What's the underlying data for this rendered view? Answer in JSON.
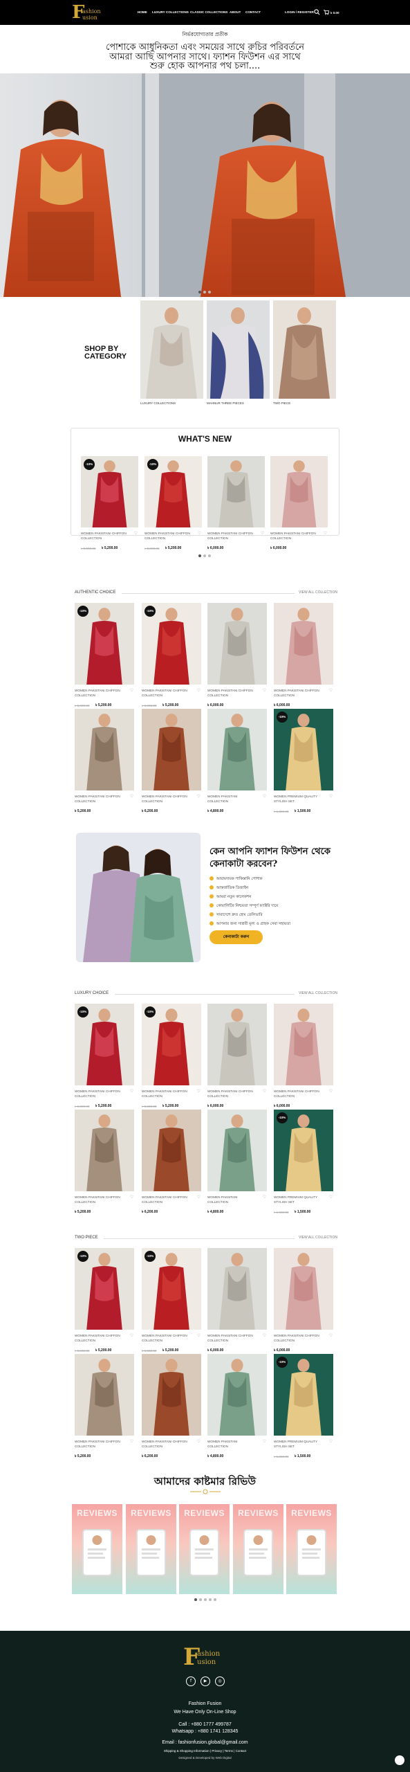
{
  "header": {
    "logo_letter": "F",
    "logo_word1": "ashion",
    "logo_word2": "usion",
    "nav": [
      "HOME",
      "LUXURY COLLECTIONS",
      "CLASSIC COLLECTIONS",
      "ABOUT",
      "CONTACT"
    ],
    "login": "LOGIN / REGISTER",
    "cart_total": "৳ 0.00",
    "cart_count": "0"
  },
  "intro": {
    "subtitle": "নির্ভরযোগ্যতার প্রতীক",
    "line1": "পোশাকে আধুনিকতা এবং সময়ের সাথে রুচির পরিবর্তনে",
    "line2": "আমরা আছি আপনার সাথে। ফ্যাশন ফিউশন এর সাথে",
    "line3": "শুরু হোক আপনার পথ চলা...."
  },
  "category": {
    "heading_line1": "SHOP BY",
    "heading_line2": "CATEGORY",
    "items": [
      "Luxury Collections",
      "Mahnur Three Pieces",
      "Two Piece"
    ]
  },
  "whats_new": {
    "title": "WHAT'S NEW",
    "products": [
      {
        "badge": "-10%",
        "name": "WOMEN PAKISTANI CHIFFON COLLECTION",
        "old": "৳ 5,800.00",
        "price": "৳ 5,200.00"
      },
      {
        "badge": "-10%",
        "name": "WOMEN PAKISTANI CHIFFON COLLECTION",
        "old": "৳ 5,800.00",
        "price": "৳ 5,200.00"
      },
      {
        "badge": "",
        "name": "WOMEN PAKISTANI CHIFFON COLLECTION",
        "old": "",
        "price": "৳ 6,000.00"
      },
      {
        "badge": "",
        "name": "WOMEN PAKISTANI CHIFFON COLLECTION",
        "old": "",
        "price": "৳ 6,000.00"
      }
    ]
  },
  "authentic": {
    "title": "AUTHENTIC CHOICE",
    "link": "VIEW ALL COLLECTION",
    "products": [
      {
        "badge": "-10%",
        "name": "WOMEN PAKISTANI CHIFFON COLLECTION",
        "old": "৳ 5,800.00",
        "price": "৳ 5,200.00"
      },
      {
        "badge": "-10%",
        "name": "WOMEN PAKISTANI CHIFFON COLLECTION",
        "old": "৳ 5,800.00",
        "price": "৳ 5,200.00"
      },
      {
        "badge": "",
        "name": "WOMEN PAKISTANI CHIFFON COLLECTION",
        "old": "",
        "price": "৳ 6,000.00"
      },
      {
        "badge": "",
        "name": "WOMEN PAKISTANI CHIFFON COLLECTION",
        "old": "",
        "price": "৳ 6,000.00"
      },
      {
        "badge": "",
        "name": "WOMEN PAKISTANI CHIFFON COLLECTION",
        "old": "",
        "price": "৳ 5,200.00"
      },
      {
        "badge": "",
        "name": "WOMEN PAKISTANI CHIFFON COLLECTION",
        "old": "",
        "price": "৳ 6,200.00"
      },
      {
        "badge": "",
        "name": "WOMEN PAKISTANI COLLECTION",
        "old": "",
        "price": "৳ 4,800.00"
      },
      {
        "badge": "-10%",
        "name": "WOMEN PREMIUM QUALITY STYLISH SET",
        "old": "৳ 1,650.00",
        "price": "৳ 1,500.00"
      }
    ]
  },
  "why": {
    "title_line1": "কেন আপনি ফ্যাশন ফিউশন থেকে",
    "title_line2": "কেনাকাটা করবেন?",
    "items": [
      "আরামদায়ক পাকিস্তানি পোশাক",
      "আন্তর্জাতিক ডিজাইন",
      "আমরা নতুন কালেকশন",
      "কোয়ালিটির নিশ্চয়তা সম্পূর্ণ ফ্যাক্টরি দামে",
      "সারাদেশে দ্রুত হোম ডেলিভারি",
      "আপনার জন্য সাশ্রয়ী মূল্য ও গ্রাহক সেবা সহায়তা"
    ],
    "button": "কেনাকাটা করুন"
  },
  "luxury": {
    "title": "LUXURY CHOICE",
    "link": "VIEW ALL COLLECTION",
    "products": [
      {
        "badge": "-10%",
        "name": "WOMEN PAKISTANI CHIFFON COLLECTION",
        "old": "৳ 5,800.00",
        "price": "৳ 5,200.00"
      },
      {
        "badge": "-10%",
        "name": "WOMEN PAKISTANI CHIFFON COLLECTION",
        "old": "৳ 5,800.00",
        "price": "৳ 5,200.00"
      },
      {
        "badge": "",
        "name": "WOMEN PAKISTANI CHIFFON COLLECTION",
        "old": "",
        "price": "৳ 6,000.00"
      },
      {
        "badge": "",
        "name": "WOMEN PAKISTANI CHIFFON COLLECTION",
        "old": "",
        "price": "৳ 6,000.00"
      },
      {
        "badge": "",
        "name": "WOMEN PAKISTANI CHIFFON COLLECTION",
        "old": "",
        "price": "৳ 5,200.00"
      },
      {
        "badge": "",
        "name": "WOMEN PAKISTANI CHIFFON COLLECTION",
        "old": "",
        "price": "৳ 6,200.00"
      },
      {
        "badge": "",
        "name": "WOMEN PAKISTANI COLLECTION",
        "old": "",
        "price": "৳ 4,800.00"
      },
      {
        "badge": "-10%",
        "name": "WOMEN PREMIUM QUALITY STYLISH SET",
        "old": "৳ 1,650.00",
        "price": "৳ 1,500.00"
      }
    ]
  },
  "twopiece": {
    "title": "TWO PIECE",
    "link": "VIEW ALL COLLECTION",
    "products": [
      {
        "badge": "-10%",
        "name": "WOMEN PAKISTANI CHIFFON COLLECTION",
        "old": "৳ 5,800.00",
        "price": "৳ 5,200.00"
      },
      {
        "badge": "-10%",
        "name": "WOMEN PAKISTANI CHIFFON COLLECTION",
        "old": "৳ 5,800.00",
        "price": "৳ 5,200.00"
      },
      {
        "badge": "",
        "name": "WOMEN PAKISTANI CHIFFON COLLECTION",
        "old": "",
        "price": "৳ 6,000.00"
      },
      {
        "badge": "",
        "name": "WOMEN PAKISTANI CHIFFON COLLECTION",
        "old": "",
        "price": "৳ 6,000.00"
      },
      {
        "badge": "",
        "name": "WOMEN PAKISTANI CHIFFON COLLECTION",
        "old": "",
        "price": "৳ 5,200.00"
      },
      {
        "badge": "",
        "name": "WOMEN PAKISTANI CHIFFON COLLECTION",
        "old": "",
        "price": "৳ 6,200.00"
      },
      {
        "badge": "",
        "name": "WOMEN PAKISTANI COLLECTION",
        "old": "",
        "price": "৳ 4,800.00"
      },
      {
        "badge": "-10%",
        "name": "WOMEN PREMIUM QUALITY STYLISH SET",
        "old": "৳ 1,650.00",
        "price": "৳ 1,500.00"
      }
    ]
  },
  "reviews": {
    "title": "আমাদের কাষ্টমার রিভিউ",
    "card_text": "REVIEWS"
  },
  "footer": {
    "name": "Fashion Fusion",
    "tagline": "We Have Only On-Line Shop",
    "call": "Call : +880 1777 499787",
    "whatsapp": "Whatsapp : +880 1741 128345",
    "email": "Email : fashionfusion.global@gmail.com",
    "links": "Shipping & Shopping Information  |  Privacy  |  Terms  |  Contact",
    "credit": "Designed & Developed by Web Digital"
  },
  "colors": {
    "accent": "#f0b323",
    "footer_bg": "#10211d",
    "gold": "#d4a93a"
  }
}
